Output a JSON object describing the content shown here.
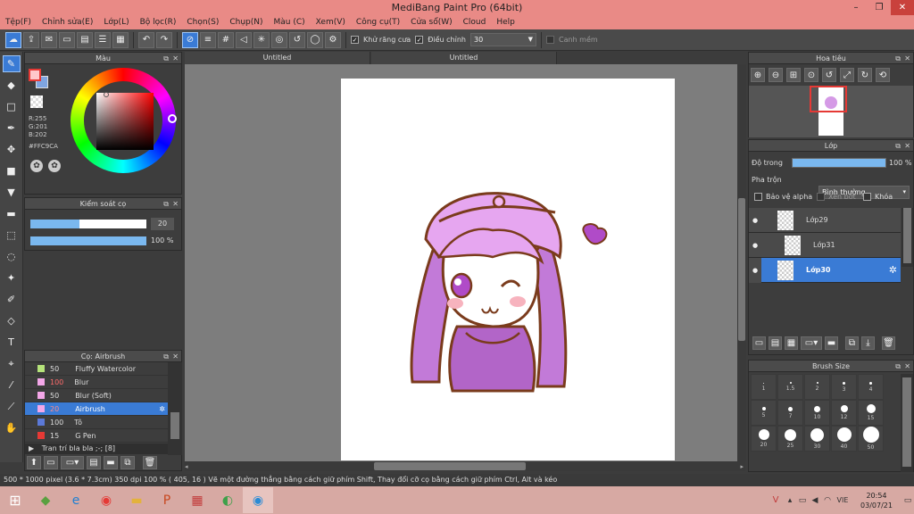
{
  "window": {
    "title": "MediBang Paint Pro (64bit)",
    "min": "–",
    "max": "❐",
    "close": "✕"
  },
  "menu": [
    "Tệp(F)",
    "Chỉnh sửa(E)",
    "Lớp(L)",
    "Bộ lọc(R)",
    "Chọn(S)",
    "Chụp(N)",
    "Màu (C)",
    "Xem(V)",
    "Công cụ(T)",
    "Cửa sổ(W)",
    "Cloud",
    "Help"
  ],
  "toolbar": {
    "antialias_label": "Khử răng cưa",
    "correction_label": "Điều chỉnh",
    "correction_value": "30",
    "snap_label": "Canh mềm"
  },
  "color_panel": {
    "title": "Màu",
    "r": "R:255",
    "g": "G:201",
    "b": "B:202",
    "hex": "#FFC9CA",
    "fg": "#ffc9ca"
  },
  "brush_control": {
    "title": "Kiểm soát cọ",
    "size": "20",
    "opacity": "100 %",
    "size_fraction": 0.42,
    "opacity_fraction": 1.0
  },
  "brush_list": {
    "title": "Cọ: Airbrush",
    "items": [
      {
        "size": "50",
        "name": "Fluffy Watercolor",
        "color": "#b5e37a"
      },
      {
        "size": "100",
        "name": "Blur",
        "color": "#f3a7e8"
      },
      {
        "size": "50",
        "name": "Blur (Soft)",
        "color": "#f3a7e8"
      },
      {
        "size": "20",
        "name": "Airbrush",
        "color": "#f3a7e8"
      },
      {
        "size": "100",
        "name": "Tô",
        "color": "#5b79d8"
      },
      {
        "size": "15",
        "name": "G Pen",
        "color": "#e53935"
      }
    ],
    "group": "Tran trí bla bla ;-; [8]"
  },
  "tabs": [
    "Untitled",
    "Untitled"
  ],
  "navigator": {
    "title": "Hoa tiêu"
  },
  "layers": {
    "title": "Lớp",
    "opacity_label": "Độ trong",
    "opacity_value": "100 %",
    "blend_label": "Pha trộn",
    "blend_value": "Bình thường",
    "protect_alpha": "Bảo vệ alpha",
    "clip": "Xén bớt",
    "lock": "Khóa",
    "items": [
      {
        "name": "Lớp29"
      },
      {
        "name": "Lớp31"
      },
      {
        "name": "Lớp30"
      }
    ]
  },
  "brush_size": {
    "title": "Brush Size",
    "sizes": [
      "1",
      "1.5",
      "2",
      "3",
      "4",
      "5",
      "7",
      "10",
      "12",
      "15",
      "20",
      "25",
      "30",
      "40",
      "50"
    ]
  },
  "status": {
    "text": "500 * 1000 pixel   (3.6 * 7.3cm)   350 dpi   100 %   ( 405, 16 )   Vẽ một đường thẳng bằng cách giữ phím Shift, Thay đổi cỡ cọ bằng cách giữ phím Ctrl, Alt và kéo"
  },
  "taskbar": {
    "lang": "VIE",
    "time": "20:54",
    "date": "03/07/21"
  }
}
